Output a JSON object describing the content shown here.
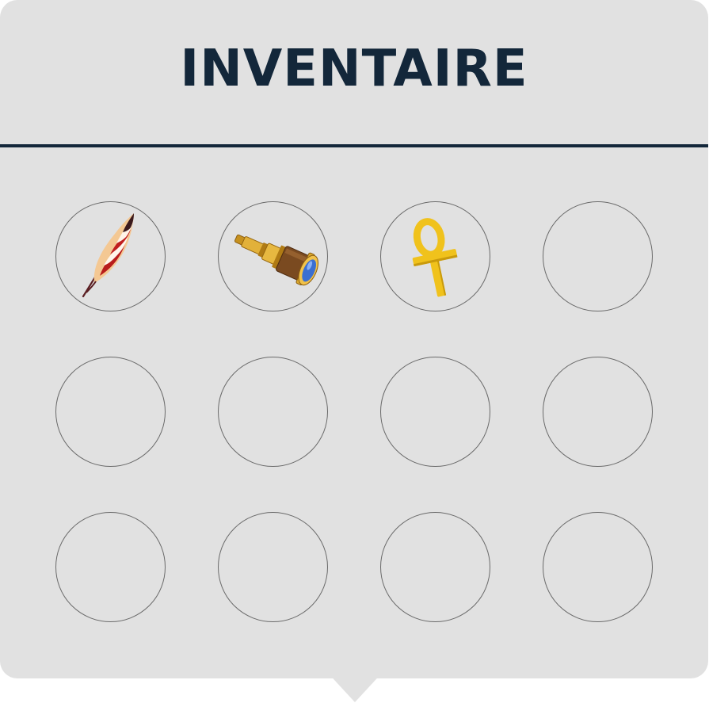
{
  "inventory": {
    "title": "INVENTAIRE",
    "colors": {
      "panel_bg": "#e1e1e1",
      "title": "#13273a",
      "divider": "#13273a",
      "slot_border": "#6a6a6a"
    },
    "slots": [
      {
        "item": "feather-icon"
      },
      {
        "item": "spyglass-icon"
      },
      {
        "item": "ankh-icon"
      },
      {
        "item": null
      },
      {
        "item": null
      },
      {
        "item": null
      },
      {
        "item": null
      },
      {
        "item": null
      },
      {
        "item": null
      },
      {
        "item": null
      },
      {
        "item": null
      },
      {
        "item": null
      }
    ]
  }
}
